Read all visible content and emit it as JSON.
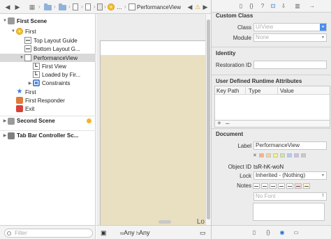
{
  "jumpbar": {
    "back": "◀",
    "forward": "▶",
    "grid": "▦",
    "separator": "›",
    "ellipsis": "...",
    "current": "PerformanceView",
    "nav_prev": "◀",
    "warning": "⚠",
    "nav_next": "▶"
  },
  "outline": {
    "items": [
      {
        "label": "First Scene",
        "tri": "▼"
      },
      {
        "label": "First",
        "tri": "▼"
      },
      {
        "label": "Top Layout Guide"
      },
      {
        "label": "Bottom Layout G..."
      },
      {
        "label": "PerformanceView",
        "tri": "▼"
      },
      {
        "label": "First View",
        "icon_text": "L"
      },
      {
        "label": "Loaded by Fir...",
        "icon_text": "L"
      },
      {
        "label": "Constraints",
        "tri": "▶"
      },
      {
        "label": "First"
      },
      {
        "label": "First Responder"
      },
      {
        "label": "Exit"
      },
      {
        "label": "Second Scene",
        "tri": "▶"
      },
      {
        "label": "Tab Bar Controller Sc...",
        "tri": "▶"
      }
    ],
    "star": "★"
  },
  "filter": {
    "placeholder": "Filter",
    "value": ""
  },
  "canvas": {
    "device_label": "Lo"
  },
  "sizebar": {
    "icon": "▣",
    "w_prefix": "w",
    "w_value": "Any",
    "h_prefix": "h",
    "h_value": "Any",
    "icon_right": "▭"
  },
  "inspector": {
    "tabs": [
      "▯",
      "{}",
      "?",
      "⊡",
      "⇩",
      "▥",
      "→"
    ],
    "custom_class": {
      "title": "Custom Class",
      "class_label": "Class",
      "class_placeholder": "UIView",
      "module_label": "Module",
      "module_placeholder": "None"
    },
    "identity": {
      "title": "Identity",
      "restoration_label": "Restoration ID",
      "restoration_value": ""
    },
    "runtime": {
      "title": "User Defined Runtime Attributes",
      "col_keypath": "Key Path",
      "col_type": "Type",
      "col_value": "Value",
      "add": "+",
      "remove": "–"
    },
    "document": {
      "title": "Document",
      "label_label": "Label",
      "label_value": "PerformanceView",
      "swatch_x": "✕",
      "swatches": [
        "#f3b38c",
        "#f6d68d",
        "#f7f091",
        "#c9ec9b",
        "#b6c8f2",
        "#d4b8f0",
        "#c8c8c8"
      ],
      "object_id_label": "Object ID",
      "object_id_value": "tsR-hK-woN",
      "lock_label": "Lock",
      "lock_value": "Inherited - (Nothing)",
      "notes_label": "Notes",
      "font_placeholder": "No Font"
    },
    "bottom_icons": [
      "▯",
      "{}",
      "◉",
      "▭"
    ]
  }
}
